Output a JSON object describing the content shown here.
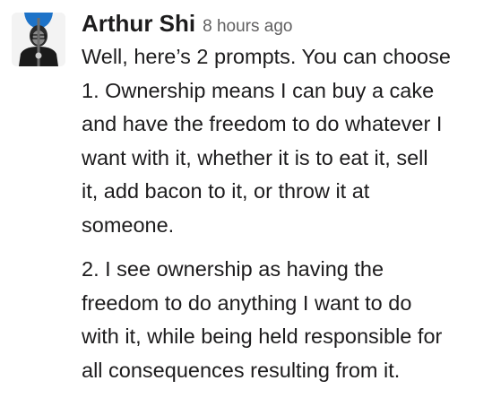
{
  "message": {
    "author": "Arthur Shi",
    "timestamp": "8 hours ago",
    "avatar_icon": "user-avatar-photo",
    "paragraphs": [
      {
        "lines": [
          "Well, here’s 2 prompts. You can choose",
          "1. Ownership means I can buy a cake",
          "and have the freedom to do whatever I",
          "want with it, whether it is to eat it, sell",
          "it, add bacon to it, or throw it at",
          "someone."
        ]
      },
      {
        "lines": [
          "2. I see ownership as having the",
          "freedom to do anything I want to do",
          "with it, while being held responsible for",
          "all consequences resulting from it."
        ]
      }
    ]
  }
}
